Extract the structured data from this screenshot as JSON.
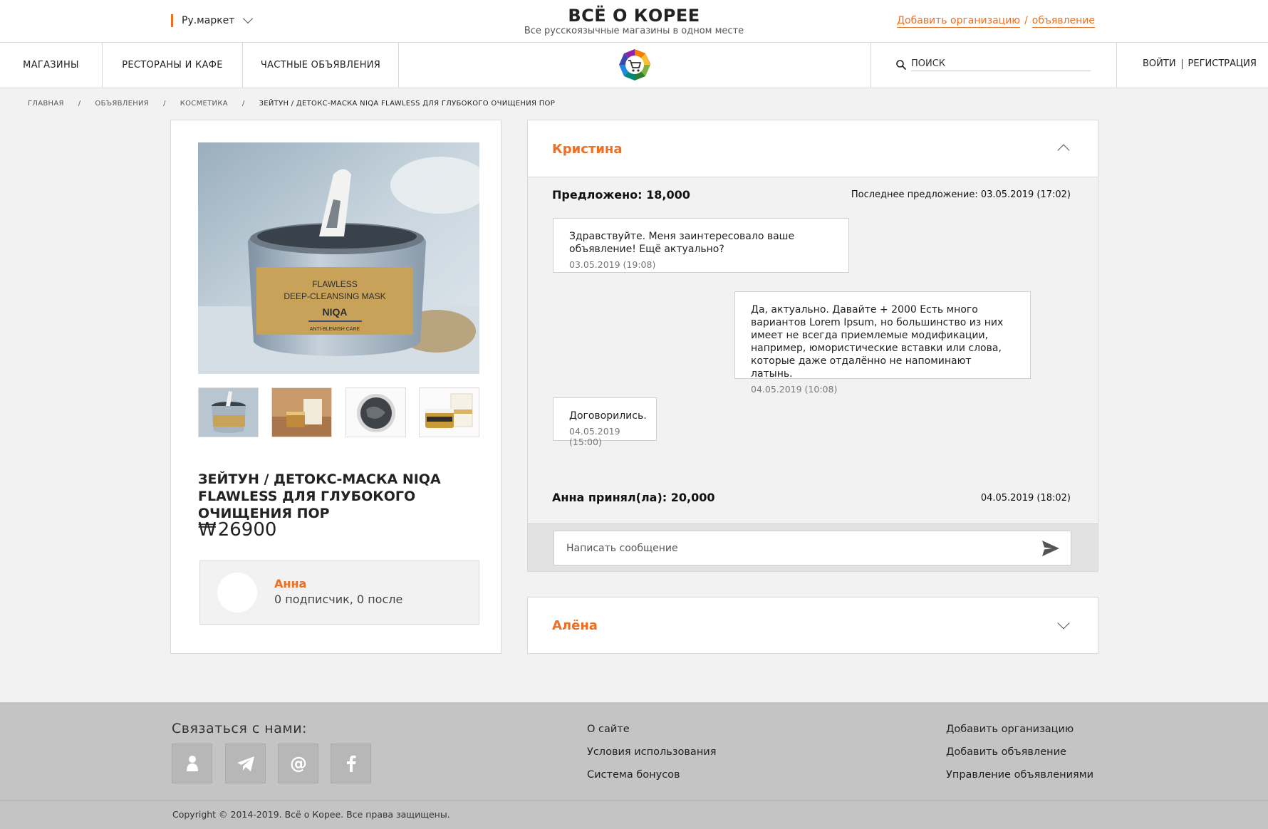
{
  "header": {
    "market_select": "Ру.маркет",
    "site_title": "ВСЁ О КОРЕЕ",
    "site_subtitle": "Все русскоязычные магазины в одном месте",
    "add_org_link": "Добавить организацию",
    "link_separator": "/",
    "add_ad_link": "объявление"
  },
  "nav": {
    "items": [
      {
        "label": "МАГАЗИНЫ"
      },
      {
        "label": "РЕСТОРАНЫ И КАФЕ"
      },
      {
        "label": "ЧАСТНЫЕ ОБЪЯВЛЕНИЯ"
      }
    ],
    "search_placeholder": "поиск",
    "login": "ВОЙТИ",
    "register": "РЕГИСТРАЦИЯ"
  },
  "breadcrumb": {
    "items": [
      "ГЛАВНАЯ",
      "ОБЪЯВЛЕНИЯ",
      "КОСМЕТИКА"
    ],
    "current": "ЗЕЙТУН / ДЕТОКС-МАСКА NIQA FLAWLESS ДЛЯ ГЛУБОКОГО ОЧИЩЕНИЯ ПОР",
    "separator": "/"
  },
  "product": {
    "image_jar_label_line1": "FLAWLESS",
    "image_jar_label_line2": "DEEP-CLEANSING MASK",
    "image_jar_brand": "NIQA",
    "image_jar_sub": "ANTI-BLEMISH CARE",
    "title": "ЗЕЙТУН / ДЕТОКС-МАСКА NIQA FLAWLESS ДЛЯ ГЛУБОКОГО ОЧИЩЕНИЯ ПОР",
    "currency": "₩",
    "price": "26900",
    "seller": {
      "name": "Анна",
      "stats": "0 подписчик, 0 после"
    }
  },
  "chat": {
    "name": "Кристина",
    "offered": "Предложено: 18,000",
    "last_offer": "Последнее предложение: 03.05.2019 (17:02)",
    "messages": [
      {
        "text": "Здравствуйте. Меня заинтересовало ваше объявление! Ещё актуально?",
        "time": "03.05.2019 (19:08)"
      },
      {
        "text": "Да, актуально. Давайте + 2000 Есть много вариантов Lorem Ipsum, но большинство из них имеет не всегда приемлемые модификации, например, юмористические вставки или слова, которые даже отдалённо не напоминают латынь.",
        "time": "04.05.2019 (10:08)"
      },
      {
        "text": "Договорились.",
        "time": "04.05.2019 (15:00)"
      }
    ],
    "accepted": "Анна принял(ла): 20,000",
    "accepted_time": "04.05.2019 (18:02)",
    "compose_placeholder": "Написать сообщение"
  },
  "chat2": {
    "name": "Алёна"
  },
  "footer": {
    "contact_title": "Связаться с нами:",
    "social_icons": [
      "person-icon",
      "telegram-icon",
      "at-icon",
      "facebook-icon"
    ],
    "col1": [
      "О сайте",
      "Условия использования",
      "Система бонусов"
    ],
    "col2": [
      "Добавить организацию",
      "Добавить объявление",
      "Управление объявлениями"
    ],
    "copyright": "Copyright © 2014-2019. Всё о Корее. Все права защищены."
  },
  "colors": {
    "accent": "#ee6e22",
    "footer_bg": "#c4c4c4",
    "page_bg": "#f2f2f2"
  }
}
